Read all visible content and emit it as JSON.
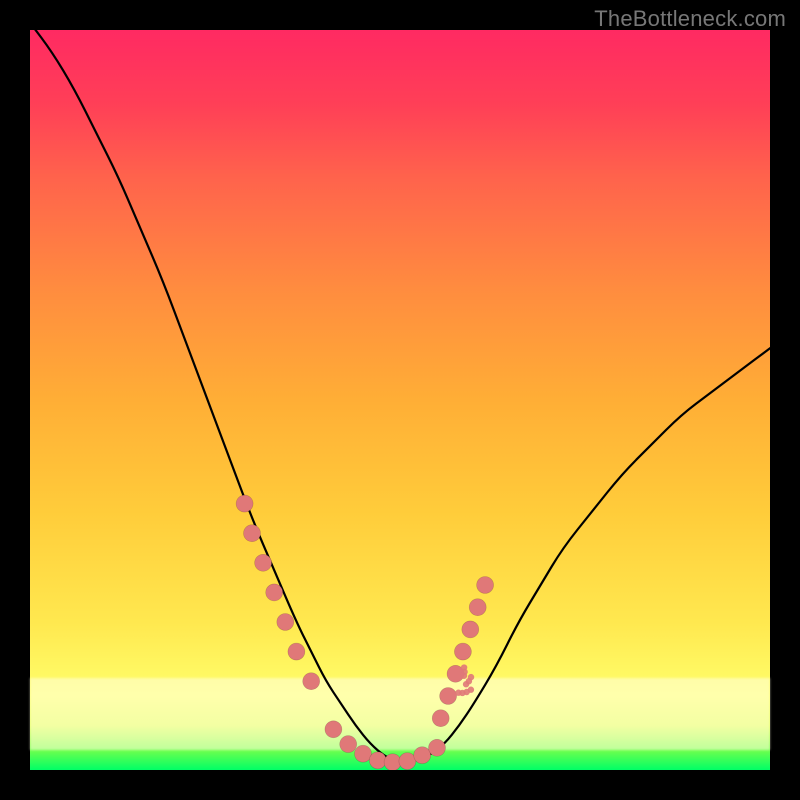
{
  "watermark": "TheBottleneck.com",
  "chart_data": {
    "type": "line",
    "title": "",
    "xlabel": "",
    "ylabel": "",
    "xlim": [
      0,
      100
    ],
    "ylim": [
      0,
      100
    ],
    "series": [
      {
        "name": "bottleneck-curve",
        "x": [
          0,
          3,
          6,
          9,
          12,
          15,
          18,
          21,
          24,
          27,
          30,
          33,
          36,
          38,
          40,
          42,
          44,
          46,
          48,
          50,
          52,
          54,
          56,
          58,
          60,
          63,
          66,
          69,
          72,
          76,
          80,
          84,
          88,
          92,
          96,
          100
        ],
        "y": [
          101,
          97,
          92,
          86,
          80,
          73,
          66,
          58,
          50,
          42,
          34,
          27,
          20,
          16,
          12,
          9,
          6,
          3.5,
          1.8,
          1,
          1.2,
          2,
          3.5,
          6,
          9,
          14,
          20,
          25,
          30,
          35,
          40,
          44,
          48,
          51,
          54,
          57
        ]
      }
    ],
    "markers": [
      {
        "name": "left-cluster",
        "points": [
          {
            "x": 29,
            "y": 36
          },
          {
            "x": 30,
            "y": 32
          },
          {
            "x": 31.5,
            "y": 28
          },
          {
            "x": 33,
            "y": 24
          },
          {
            "x": 34.5,
            "y": 20
          },
          {
            "x": 36,
            "y": 16
          },
          {
            "x": 38,
            "y": 12
          }
        ]
      },
      {
        "name": "valley-cluster",
        "points": [
          {
            "x": 41,
            "y": 5.5
          },
          {
            "x": 43,
            "y": 3.5
          },
          {
            "x": 45,
            "y": 2.2
          },
          {
            "x": 47,
            "y": 1.3
          },
          {
            "x": 49,
            "y": 1.05
          },
          {
            "x": 51,
            "y": 1.2
          },
          {
            "x": 53,
            "y": 2
          },
          {
            "x": 55,
            "y": 3
          }
        ]
      },
      {
        "name": "right-cluster",
        "points": [
          {
            "x": 55.5,
            "y": 7
          },
          {
            "x": 56.5,
            "y": 10
          },
          {
            "x": 57.5,
            "y": 13
          },
          {
            "x": 58.5,
            "y": 16
          },
          {
            "x": 59.5,
            "y": 19
          },
          {
            "x": 60.5,
            "y": 22
          },
          {
            "x": 61.5,
            "y": 25
          }
        ]
      }
    ],
    "flake_cluster": {
      "cx": 57,
      "cy": 12,
      "spread": 3,
      "count": 10
    },
    "colors": {
      "curve": "#000000",
      "marker": "#e07878",
      "gradient_top": "#ff2a62",
      "gradient_bottom": "#00ff66",
      "band": "#ffffe0"
    }
  }
}
